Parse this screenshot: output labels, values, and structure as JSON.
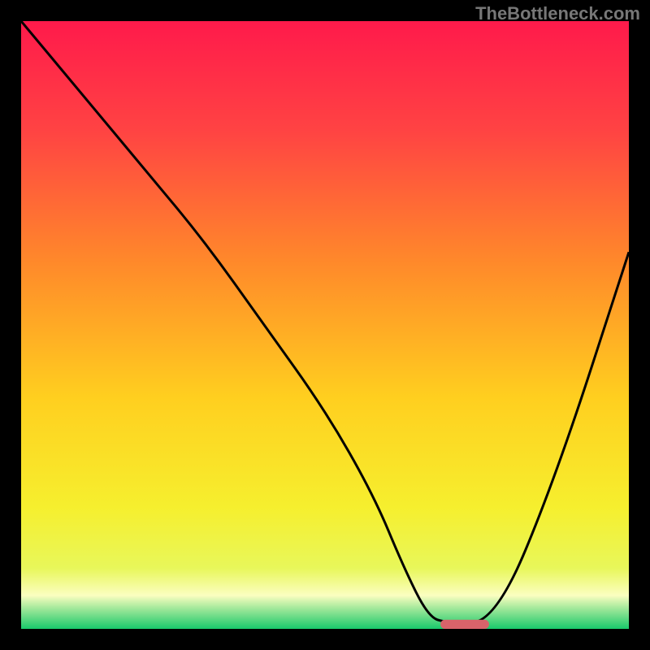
{
  "watermark": "TheBottleneck.com",
  "chart_data": {
    "type": "line",
    "title": "",
    "xlabel": "",
    "ylabel": "",
    "xlim": [
      0,
      100
    ],
    "ylim": [
      0,
      100
    ],
    "grid": false,
    "legend": false,
    "series": [
      {
        "name": "curve",
        "type": "line",
        "color": "#000000",
        "x": [
          0,
          10,
          20,
          30,
          40,
          50,
          58,
          63,
          67,
          70,
          78,
          88,
          100
        ],
        "y": [
          100,
          88,
          76,
          64,
          50,
          36,
          22,
          10,
          2,
          1,
          1,
          25,
          62
        ]
      },
      {
        "name": "optimal-marker",
        "type": "bar",
        "color": "#d9636a",
        "x": [
          73
        ],
        "width": 8,
        "y": [
          1.5
        ]
      }
    ],
    "background_gradient": {
      "stops": [
        {
          "offset": 0.0,
          "color": "#ff1a4b"
        },
        {
          "offset": 0.18,
          "color": "#ff4343"
        },
        {
          "offset": 0.4,
          "color": "#ff8a2a"
        },
        {
          "offset": 0.62,
          "color": "#ffcf1f"
        },
        {
          "offset": 0.8,
          "color": "#f6ef2e"
        },
        {
          "offset": 0.9,
          "color": "#e8f75a"
        },
        {
          "offset": 0.945,
          "color": "#fbfec0"
        },
        {
          "offset": 0.965,
          "color": "#a7e99c"
        },
        {
          "offset": 1.0,
          "color": "#19c96b"
        }
      ]
    }
  }
}
